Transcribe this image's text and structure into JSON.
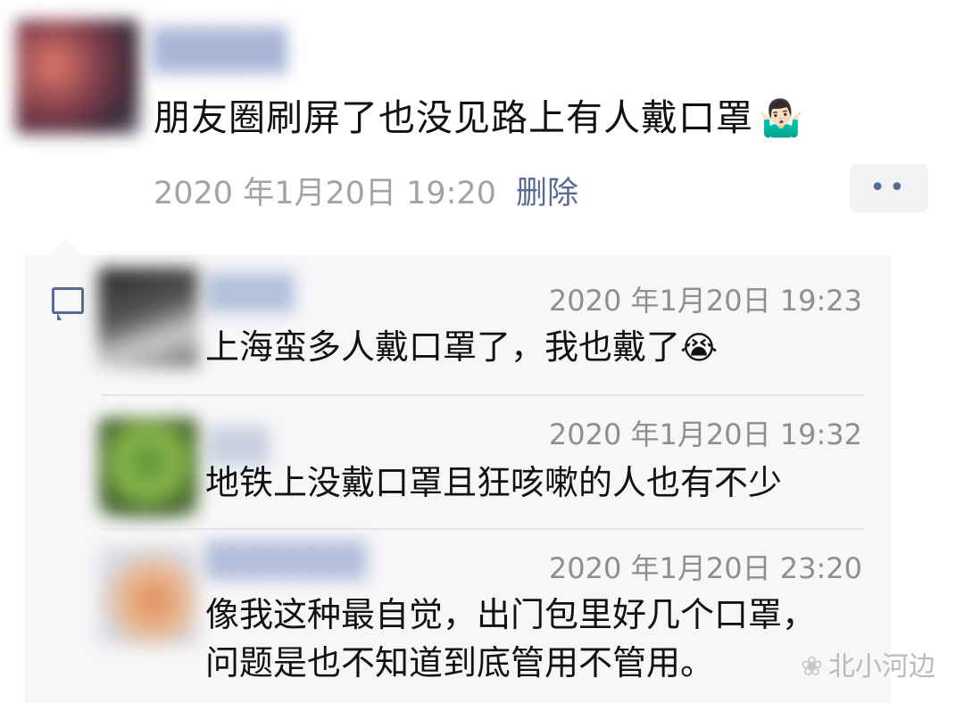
{
  "post": {
    "text": "朋友圈刷屏了也没见路上有人戴口罩",
    "emoji": "🤷🏻‍♂️",
    "timestamp": "2020 年1月20日 19:20",
    "delete_label": "删除",
    "more_label": "••"
  },
  "comments": [
    {
      "time": "2020 年1月20日 19:23",
      "text": "上海蛮多人戴口罩了，我也戴了",
      "emoji": "😭"
    },
    {
      "time": "2020 年1月20日 19:32",
      "text": "地铁上没戴口罩且狂咳嗽的人也有不少"
    },
    {
      "time": "2020 年1月20日 23:20",
      "text_line1": "像我这种最自觉，出门包里好几个口罩，",
      "text_line2": "问题是也不知道到底管用不管用。"
    }
  ],
  "watermark": {
    "icon": "wechat-icon",
    "text": "北小河边"
  },
  "colors": {
    "link": "#576b95",
    "meta_gray": "#a3a3a3",
    "panel_bg": "#f7f7f8"
  }
}
